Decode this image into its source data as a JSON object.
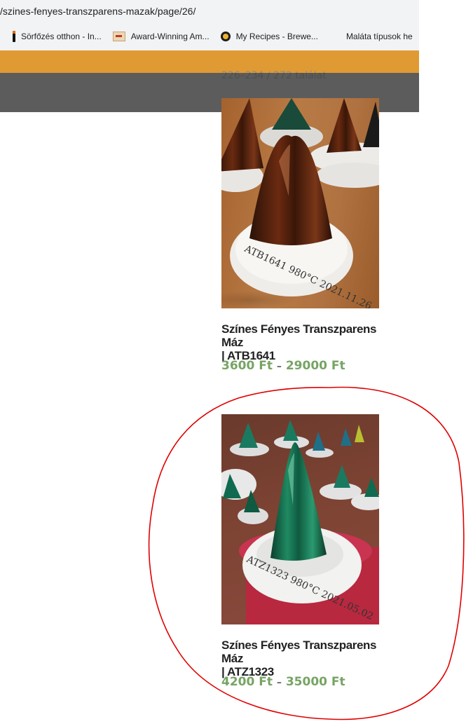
{
  "browser": {
    "url": "/szines-fenyes-transzparens-mazak/page/26/",
    "bookmarks": [
      {
        "label": "Sörfőzés otthon - In...",
        "icon": "bottle-icon"
      },
      {
        "label": "Award-Winning Am...",
        "icon": "site-logo-icon"
      },
      {
        "label": "My Recipes - Brewe...",
        "icon": "brewer-icon"
      },
      {
        "label": "Maláta típusok he",
        "icon": ""
      }
    ]
  },
  "results": {
    "count_text": "226–234 / 272 találat"
  },
  "products": [
    {
      "title_line1": "Színes Fényes Transzparens Máz",
      "title_line2": "| ATB1641",
      "price_min": "3600 Ft",
      "price_sep": "–",
      "price_max": "29000 Ft",
      "image_label": "ATB1641 980°C 2021.11.26."
    },
    {
      "title_line1": "Színes Fényes Transzparens Máz",
      "title_line2": "| ATZ1323",
      "price_min": "4200 Ft",
      "price_sep": "–",
      "price_max": "35000 Ft",
      "image_label": "ATZ1323 980°C 2021.05.02"
    }
  ],
  "colors": {
    "header_bar": "#e09a33",
    "overlay_bar": "#464646",
    "price": "#77a464",
    "annotation": "#e00000"
  }
}
